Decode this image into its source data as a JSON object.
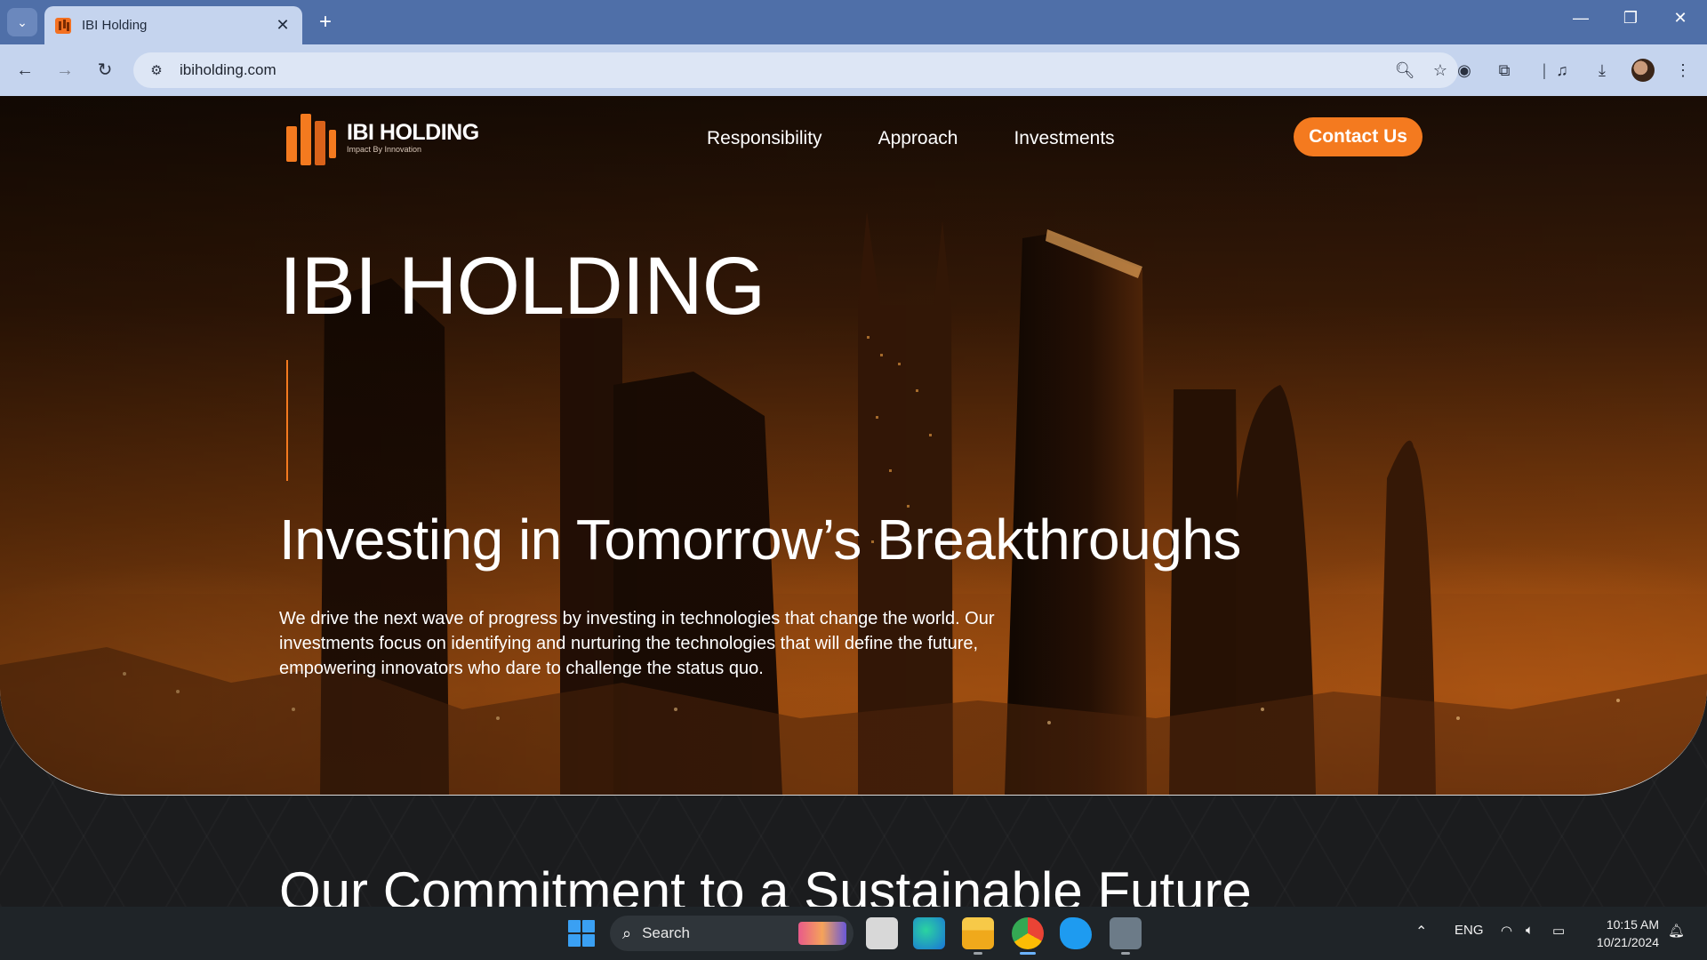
{
  "browser": {
    "tab_title": "IBI Holding",
    "url": "ibiholding.com",
    "new_tab_glyph": "+",
    "tab_close_glyph": "✕",
    "window_controls": [
      "—",
      "❐",
      "✕"
    ]
  },
  "site": {
    "logo": {
      "name": "IBI HOLDING",
      "tagline": "Impact By Innovation"
    },
    "nav": [
      "Responsibility",
      "Approach",
      "Investments"
    ],
    "contact_label": "Contact Us",
    "hero": {
      "title": "IBI HOLDING",
      "headline": "Investing in Tomorrow’s Breakthroughs",
      "description": "We drive the next wave of progress by investing in technologies that change the world. Our investments focus on identifying and nurturing the technologies that will define the future, empowering innovators who dare to challenge the status quo."
    },
    "next_section_title": "Our Commitment to a Sustainable Future"
  },
  "taskbar": {
    "search_label": "Search",
    "language": "ENG",
    "time": "10:15 AM",
    "date": "10/21/2024"
  },
  "colors": {
    "accent": "#f47a1f",
    "browser_frame": "#4f6fa8",
    "toolbar": "#c5d4ee"
  }
}
